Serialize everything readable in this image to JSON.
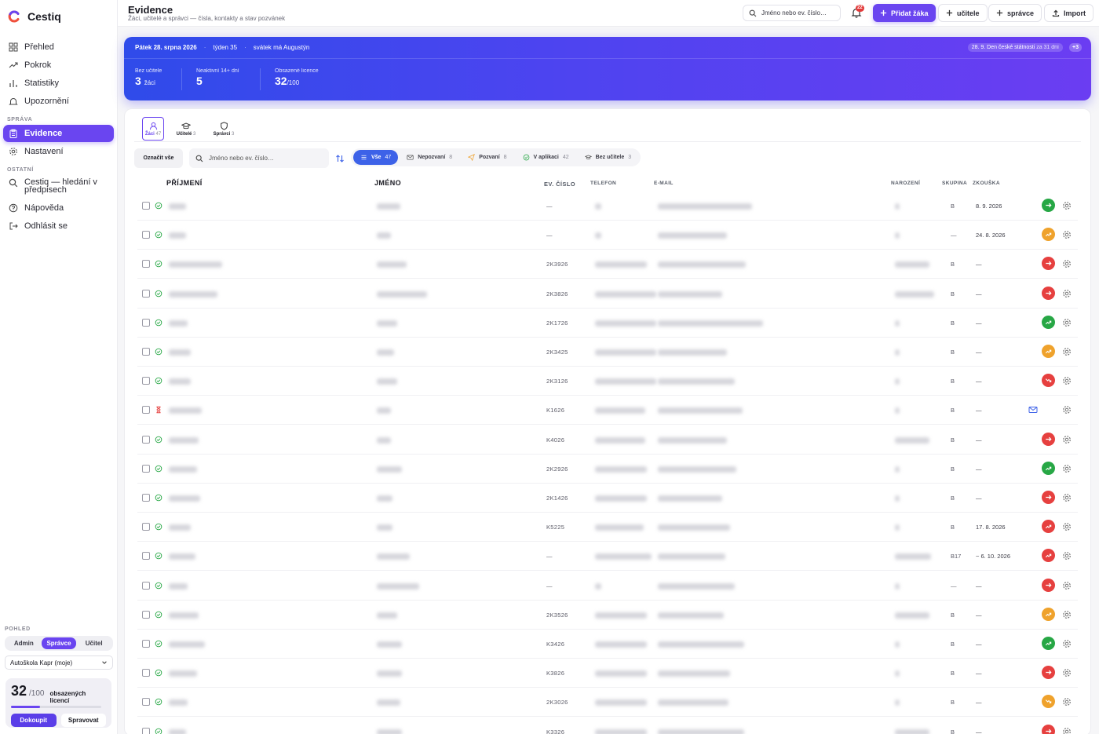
{
  "app": {
    "name": "Cestiq"
  },
  "sidebar": {
    "items": [
      {
        "label": "Přehled",
        "icon": "grid-icon"
      },
      {
        "label": "Pokrok",
        "icon": "trend-icon"
      },
      {
        "label": "Statistiky",
        "icon": "bar-chart-icon"
      },
      {
        "label": "Upozornění",
        "icon": "bell-icon"
      }
    ],
    "section_sprava": "SPRÁVA",
    "sprava_items": [
      {
        "label": "Evidence",
        "icon": "clipboard-icon",
        "active": true
      },
      {
        "label": "Nastavení",
        "icon": "gear-icon"
      }
    ],
    "section_ostatni": "OSTATNÍ",
    "ostatni_items": [
      {
        "label": "Cestiq — hledání v předpisech",
        "icon": "search-icon"
      },
      {
        "label": "Nápověda",
        "icon": "help-icon"
      },
      {
        "label": "Odhlásit se",
        "icon": "logout-icon"
      }
    ],
    "pohled_label": "POHLED",
    "roles": [
      "Admin",
      "Správce",
      "Učitel"
    ],
    "active_role": "Správce",
    "school": "Autoškola Kapr (moje)",
    "licenses": {
      "used": "32",
      "total": "/100",
      "text": "obsazených licencí",
      "fraction": 0.32,
      "buy": "Dokoupit",
      "manage": "Spravovat"
    }
  },
  "header": {
    "title": "Evidence",
    "subtitle": "Žáci, učitelé a správci — čísla, kontakty a stav pozvánek",
    "search_placeholder": "Jméno nebo ev. číslo…",
    "notifications": "22",
    "add_student": "Přidat žáka",
    "add_teacher": "učitele",
    "add_admin": "správce",
    "import": "Import"
  },
  "banner": {
    "date": "Pátek 28. srpna 2026",
    "week": "týden 35",
    "nameday": "svátek má Augustýn",
    "event": "28. 9. Den české státnosti",
    "event_in": "za 31 dní",
    "more": "+3",
    "stats": [
      {
        "label": "Bez učitele",
        "value": "3",
        "unit": "žáci"
      },
      {
        "label": "Neaktivní 14+ dní",
        "value": "5",
        "unit": ""
      },
      {
        "label": "Obsazené licence",
        "value": "32",
        "unit": "/100"
      }
    ]
  },
  "tabs": [
    {
      "label": "Žáci",
      "count": "47",
      "icon": "user-icon",
      "active": true
    },
    {
      "label": "Učitelé",
      "count": "3",
      "icon": "graduation-cap-icon"
    },
    {
      "label": "Správci",
      "count": "3",
      "icon": "shield-icon"
    }
  ],
  "list": {
    "mark_all": "Označit vše",
    "search_placeholder": "Jméno nebo ev. číslo…",
    "filters": [
      {
        "label": "Vše",
        "count": "47",
        "icon": "list-icon",
        "active": true
      },
      {
        "label": "Nepozvaní",
        "count": "8",
        "icon": "mail-icon"
      },
      {
        "label": "Pozvaní",
        "count": "8",
        "icon": "send-icon"
      },
      {
        "label": "V aplikaci",
        "count": "42",
        "icon": "check-circle-icon"
      },
      {
        "label": "Bez učitele",
        "count": "3",
        "icon": "no-teacher-icon"
      }
    ]
  },
  "table": {
    "columns": {
      "surname": "PŘÍJMENÍ",
      "name": "JMÉNO",
      "ev": "EV. ČÍSLO",
      "phone": "TELEFON",
      "email": "E-MAIL",
      "birth": "NAROZENÍ",
      "group": "SKUPINA",
      "exam": "ZKOUŠKA"
    },
    "rows": [
      {
        "status": "ok",
        "ev": "—",
        "group": "B",
        "exam": "8. 9. 2026",
        "trend": "green",
        "dir": "right",
        "w": [
          22,
          30,
          8,
          120,
          6
        ]
      },
      {
        "status": "ok",
        "ev": "—",
        "group": "—",
        "exam": "24. 8. 2026",
        "trend": "orange",
        "dir": "up",
        "w": [
          22,
          18,
          8,
          88,
          6
        ]
      },
      {
        "status": "ok",
        "ev": "2K3926",
        "group": "B",
        "exam": "—",
        "trend": "red",
        "dir": "right",
        "w": [
          68,
          38,
          66,
          112,
          44
        ]
      },
      {
        "status": "ok",
        "ev": "2K3826",
        "group": "B",
        "exam": "—",
        "trend": "red",
        "dir": "right",
        "w": [
          62,
          64,
          78,
          82,
          50
        ]
      },
      {
        "status": "ok",
        "ev": "2K1726",
        "group": "B",
        "exam": "—",
        "trend": "green",
        "dir": "up",
        "w": [
          24,
          26,
          78,
          134,
          6
        ]
      },
      {
        "status": "ok",
        "ev": "2K3425",
        "group": "B",
        "exam": "—",
        "trend": "orange",
        "dir": "up",
        "w": [
          28,
          22,
          78,
          88,
          6
        ]
      },
      {
        "status": "ok",
        "ev": "2K3126",
        "group": "B",
        "exam": "—",
        "trend": "red",
        "dir": "down",
        "w": [
          28,
          26,
          78,
          98,
          6
        ]
      },
      {
        "status": "pending",
        "ev": "K1626",
        "group": "B",
        "exam": "—",
        "trend": "mail",
        "dir": "",
        "w": [
          42,
          18,
          64,
          108,
          6
        ]
      },
      {
        "status": "ok",
        "ev": "K4026",
        "group": "B",
        "exam": "—",
        "trend": "red",
        "dir": "right",
        "w": [
          38,
          18,
          64,
          88,
          44
        ]
      },
      {
        "status": "ok",
        "ev": "2K2926",
        "group": "B",
        "exam": "—",
        "trend": "green",
        "dir": "up",
        "w": [
          36,
          32,
          66,
          100,
          6
        ]
      },
      {
        "status": "ok",
        "ev": "2K1426",
        "group": "B",
        "exam": "—",
        "trend": "red",
        "dir": "right",
        "w": [
          40,
          20,
          66,
          82,
          6
        ]
      },
      {
        "status": "ok",
        "ev": "K5225",
        "group": "B",
        "exam": "17. 8. 2026",
        "trend": "red",
        "dir": "up",
        "w": [
          28,
          20,
          62,
          92,
          6
        ]
      },
      {
        "status": "ok",
        "ev": "—",
        "group": "B17",
        "exam": "~ 6. 10. 2026",
        "trend": "red",
        "dir": "up",
        "w": [
          34,
          42,
          72,
          86,
          46
        ]
      },
      {
        "status": "ok",
        "ev": "—",
        "group": "—",
        "exam": "—",
        "trend": "red",
        "dir": "right",
        "w": [
          24,
          54,
          8,
          98,
          6
        ]
      },
      {
        "status": "ok",
        "ev": "2K3526",
        "group": "B",
        "exam": "—",
        "trend": "orange",
        "dir": "up",
        "w": [
          38,
          26,
          66,
          84,
          44
        ]
      },
      {
        "status": "ok",
        "ev": "K3426",
        "group": "B",
        "exam": "—",
        "trend": "green",
        "dir": "up",
        "w": [
          46,
          32,
          66,
          110,
          6
        ]
      },
      {
        "status": "ok",
        "ev": "K3826",
        "group": "B",
        "exam": "—",
        "trend": "red",
        "dir": "right",
        "w": [
          36,
          32,
          66,
          92,
          6
        ]
      },
      {
        "status": "ok",
        "ev": "2K3026",
        "group": "B",
        "exam": "—",
        "trend": "orange",
        "dir": "down",
        "w": [
          24,
          30,
          66,
          90,
          6
        ]
      },
      {
        "status": "ok",
        "ev": "K3326",
        "group": "B",
        "exam": "—",
        "trend": "red",
        "dir": "right",
        "w": [
          22,
          32,
          66,
          110,
          44
        ]
      }
    ]
  },
  "colors": {
    "accent": "#6a45f0",
    "green": "#27a745",
    "orange": "#efa22c",
    "red": "#e6403f"
  }
}
